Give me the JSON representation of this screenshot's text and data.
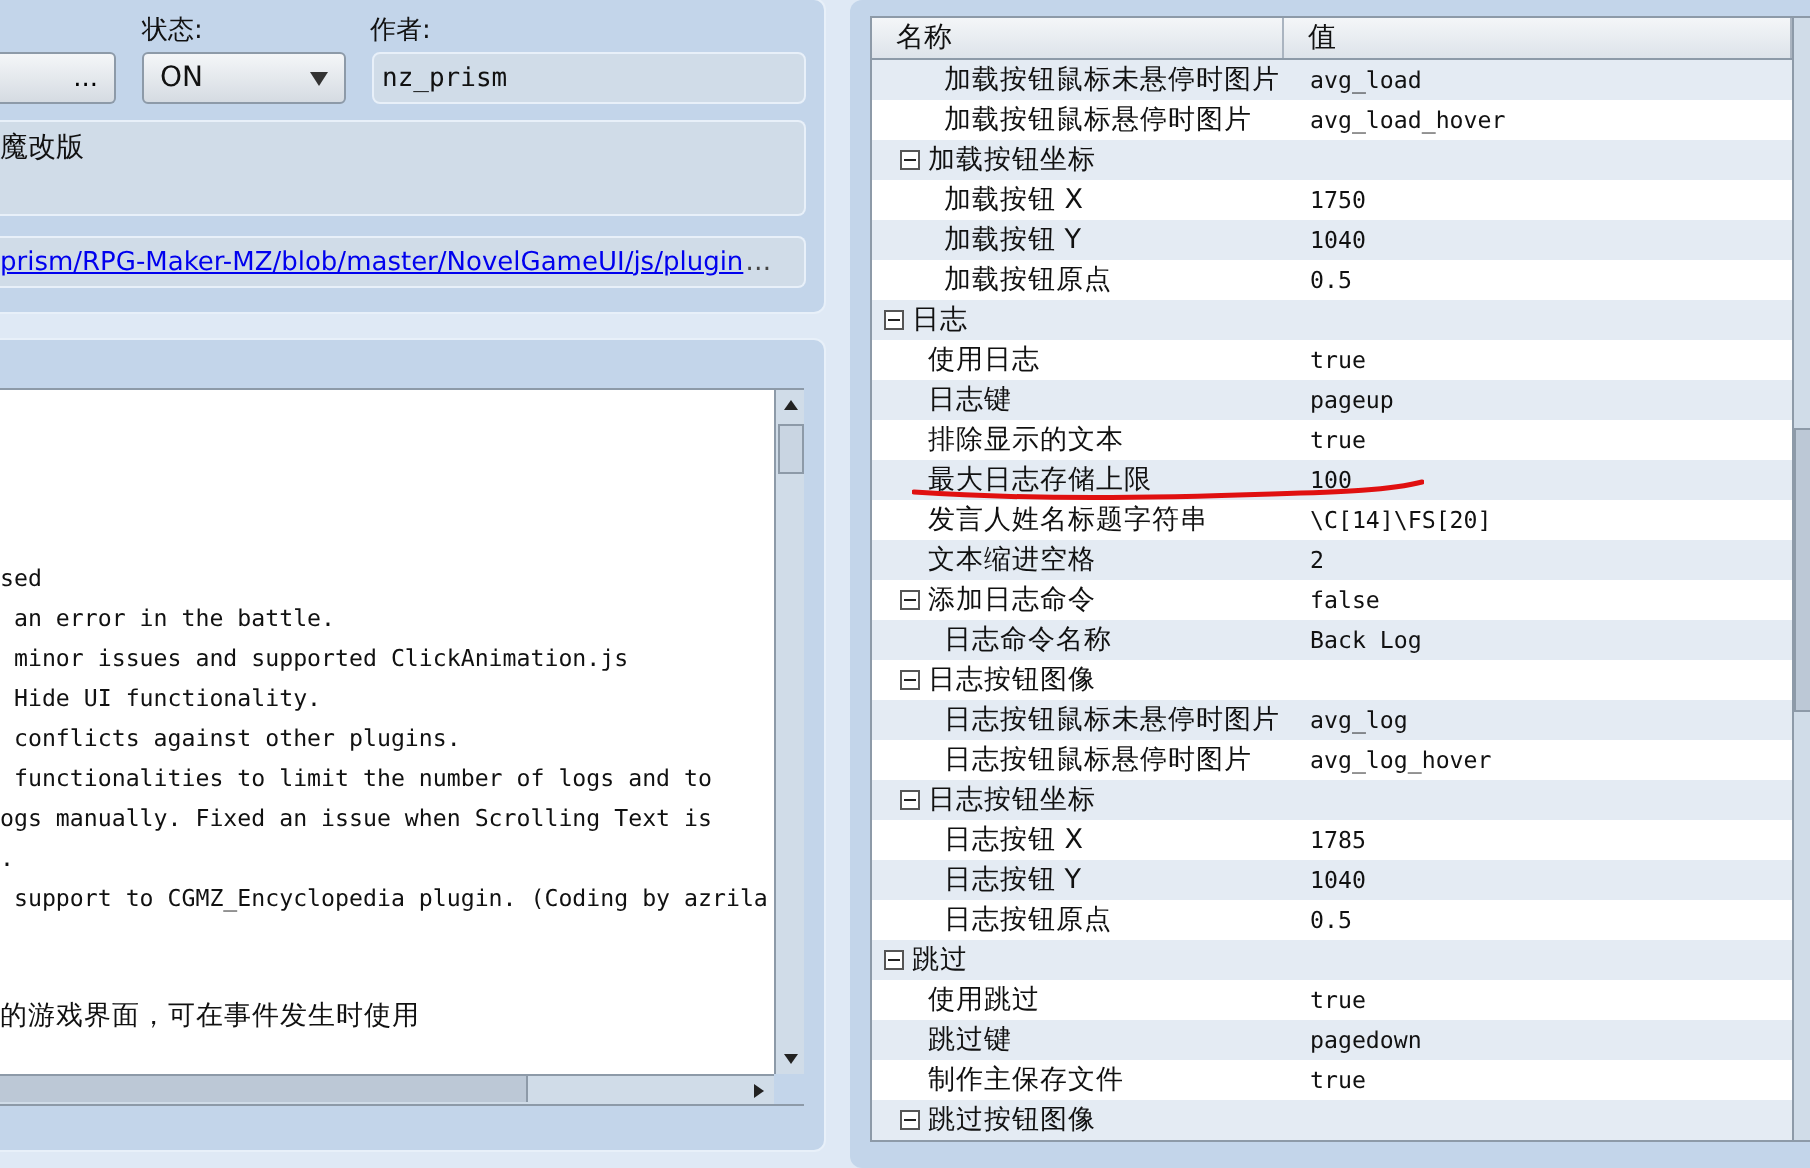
{
  "plugin": {
    "browse_button": "...",
    "status": {
      "label": "状态:",
      "value": "ON"
    },
    "author": {
      "label": "作者:",
      "value": "nz_prism"
    },
    "description": "魔改版",
    "link": "prism/RPG-Maker-MZ/blob/master/NovelGameUI/js/plugin",
    "link_more": "…"
  },
  "help_text": {
    "lines": [
      "sed",
      " an error in the battle.",
      " minor issues and supported ClickAnimation.js",
      " Hide UI functionality.",
      " conflicts against other plugins.",
      " functionalities to limit the number of logs and to",
      "ogs manually. Fixed an issue when Scrolling Text is",
      ".",
      " support to CGMZ_Encyclopedia plugin. (Coding by azrila"
    ],
    "note": "的游戏界面，可在事件发生时使用"
  },
  "parameters": {
    "columns": [
      "名称",
      "值"
    ],
    "tree": [
      {
        "children": [
          {
            "children": [
              {
                "name": "加载按钮鼠标未悬停时图片",
                "value": "avg_load"
              },
              {
                "name": "加载按钮鼠标悬停时图片",
                "value": "avg_load_hover"
              }
            ]
          },
          {
            "name": "加载按钮坐标",
            "expanded": true,
            "children": [
              {
                "name": "加载按钮 X",
                "value": "1750"
              },
              {
                "name": "加载按钮 Y",
                "value": "1040"
              },
              {
                "name": "加载按钮原点",
                "value": "0.5"
              }
            ]
          }
        ]
      },
      {
        "name": "日志",
        "expanded": true,
        "children": [
          {
            "name": "使用日志",
            "value": "true"
          },
          {
            "name": "日志键",
            "value": "pageup"
          },
          {
            "name": "排除显示的文本",
            "value": "true"
          },
          {
            "name": "最大日志存储上限",
            "value": "100"
          },
          {
            "name": "发言人姓名标题字符串",
            "value": "\\C[14]\\FS[20]"
          },
          {
            "name": "文本缩进空格",
            "value": "2"
          },
          {
            "name": "添加日志命令",
            "value": "false",
            "expanded": true,
            "children": [
              {
                "name": "日志命令名称",
                "value": "Back Log"
              }
            ]
          },
          {
            "name": "日志按钮图像",
            "expanded": true,
            "children": [
              {
                "name": "日志按钮鼠标未悬停时图片",
                "value": "avg_log"
              },
              {
                "name": "日志按钮鼠标悬停时图片",
                "value": "avg_log_hover"
              }
            ]
          },
          {
            "name": "日志按钮坐标",
            "expanded": true,
            "children": [
              {
                "name": "日志按钮 X",
                "value": "1785"
              },
              {
                "name": "日志按钮 Y",
                "value": "1040"
              },
              {
                "name": "日志按钮原点",
                "value": "0.5"
              }
            ]
          }
        ]
      },
      {
        "name": "跳过",
        "expanded": true,
        "children": [
          {
            "name": "使用跳过",
            "value": "true"
          },
          {
            "name": "跳过键",
            "value": "pagedown"
          },
          {
            "name": "制作主保存文件",
            "value": "true"
          },
          {
            "name": "跳过按钮图像",
            "expanded": true
          }
        ]
      }
    ]
  }
}
